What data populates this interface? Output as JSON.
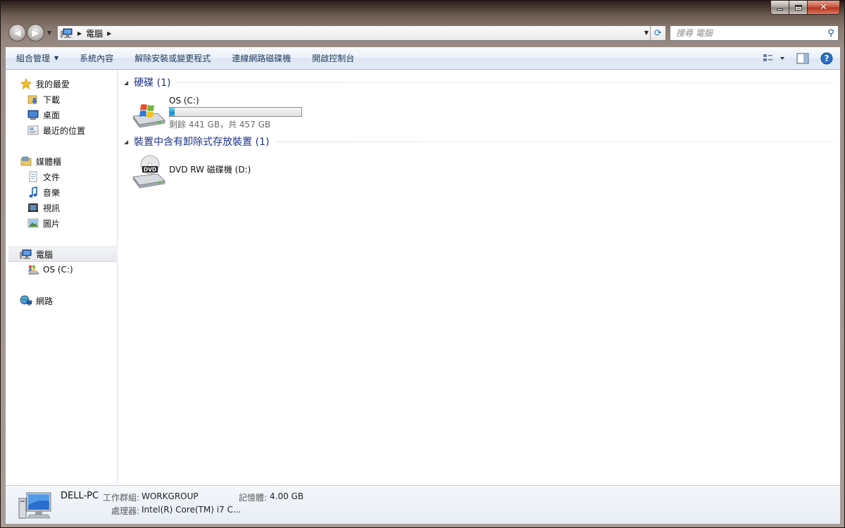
{
  "nav": {
    "address_root": "電腦",
    "search_placeholder": "搜尋 電腦"
  },
  "toolbar": {
    "organize": "組合管理",
    "system_properties": "系統內容",
    "uninstall": "解除安裝或變更程式",
    "map_drive": "連線網路磁碟機",
    "control_panel": "開啟控制台"
  },
  "sidebar": {
    "favorites": {
      "label": "我的最愛",
      "items": [
        {
          "label": "下載",
          "icon": "downloads-icon"
        },
        {
          "label": "桌面",
          "icon": "desktop-icon"
        },
        {
          "label": "最近的位置",
          "icon": "recent-places-icon"
        }
      ]
    },
    "libraries": {
      "label": "媒體櫃",
      "items": [
        {
          "label": "文件",
          "icon": "documents-icon"
        },
        {
          "label": "音樂",
          "icon": "music-icon"
        },
        {
          "label": "視訊",
          "icon": "videos-icon"
        },
        {
          "label": "圖片",
          "icon": "pictures-icon"
        }
      ]
    },
    "computer": {
      "label": "電腦",
      "items": [
        {
          "label": "OS (C:)",
          "icon": "drive-icon"
        }
      ]
    },
    "network": {
      "label": "網路"
    }
  },
  "content": {
    "hard_disks_header": "硬碟 (1)",
    "removable_header": "裝置中含有卸除式存放裝置 (1)",
    "drive_c": {
      "name": "OS (C:)",
      "space": "剩餘 441 GB，共 457 GB",
      "used_fraction": 0.035
    },
    "drive_d": {
      "name": "DVD RW 磁碟機 (D:)",
      "disc_label": "DVD"
    }
  },
  "details": {
    "computer_name": "DELL-PC",
    "workgroup_label": "工作群組:",
    "workgroup_value": "WORKGROUP",
    "memory_label": "記憶體:",
    "memory_value": "4.00 GB",
    "processor_label": "處理器:",
    "processor_value": "Intel(R) Core(TM) i7 C..."
  },
  "colors": {
    "accent_header": "#1e3287",
    "progress": "#26a0da"
  }
}
